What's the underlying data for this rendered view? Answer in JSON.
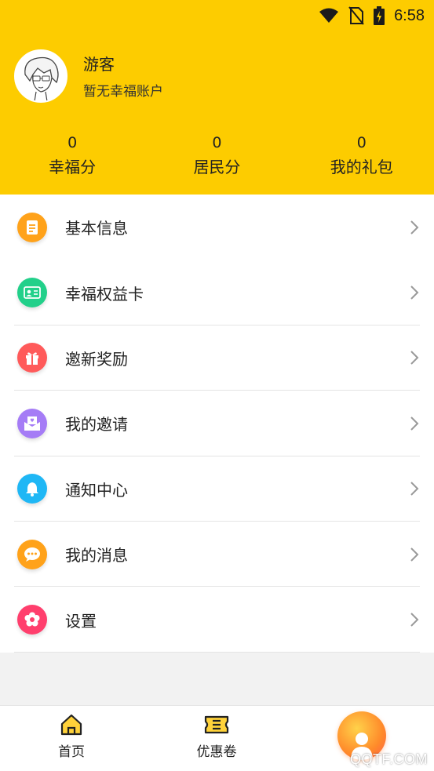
{
  "status_bar": {
    "time": "6:58",
    "icons": [
      "wifi-icon",
      "no-sim-icon",
      "battery-charging-icon"
    ]
  },
  "profile": {
    "name": "游客",
    "subtitle": "暂无幸福账户",
    "avatar": "anime-boy-avatar"
  },
  "stats": [
    {
      "value": "0",
      "label": "幸福分"
    },
    {
      "value": "0",
      "label": "居民分"
    },
    {
      "value": "0",
      "label": "我的礼包"
    }
  ],
  "menu": [
    {
      "label": "基本信息",
      "icon": "document-icon",
      "color": "#ffa21a"
    },
    {
      "label": "幸福权益卡",
      "icon": "id-card-icon",
      "color": "#22d08a"
    },
    {
      "label": "邀新奖励",
      "icon": "gift-icon",
      "color": "#ff5a5a"
    },
    {
      "label": "我的邀请",
      "icon": "envelope-heart-icon",
      "color": "#a57cf6"
    },
    {
      "label": "通知中心",
      "icon": "bell-icon",
      "color": "#1fb7f5"
    },
    {
      "label": "我的消息",
      "icon": "chat-icon",
      "color": "#ffa21a"
    },
    {
      "label": "设置",
      "icon": "flower-settings-icon",
      "color": "#ff3f6d"
    }
  ],
  "tabbar": {
    "home": "首页",
    "coupons": "优惠卷"
  },
  "watermark": "QQTF.COM",
  "colors": {
    "header_bg": "#fdcc00",
    "accent": "#ffa21a"
  }
}
